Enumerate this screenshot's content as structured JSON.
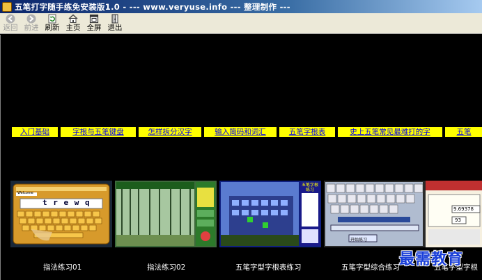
{
  "window": {
    "title": "五笔打字随手练免安装版1.0 - --- www.veryuse.info --- 整理制作 ---"
  },
  "toolbar": {
    "buttons": [
      {
        "label": "返回",
        "icon": "back-arrow-icon",
        "enabled": false
      },
      {
        "label": "前进",
        "icon": "forward-arrow-icon",
        "enabled": false
      },
      {
        "label": "刷新",
        "icon": "refresh-icon",
        "enabled": true
      },
      {
        "label": "主页",
        "icon": "home-icon",
        "enabled": true
      },
      {
        "label": "全屏",
        "icon": "fullscreen-icon",
        "enabled": true
      },
      {
        "label": "退出",
        "icon": "exit-icon",
        "enabled": true
      }
    ]
  },
  "nav_links": [
    {
      "label": "入门基础"
    },
    {
      "label": "字根与五笔键盘"
    },
    {
      "label": "怎样拆分汉字"
    },
    {
      "label": "输入简码和词汇"
    },
    {
      "label": "五笔字根表"
    },
    {
      "label": "史上五笔常见最难打的字"
    },
    {
      "label": "五笔"
    }
  ],
  "thumbnails": [
    {
      "caption": "指法练习01",
      "screen_text": "t r e w q",
      "preview_label": "Welcome"
    },
    {
      "caption": "指法练习02"
    },
    {
      "caption": "五笔字型字根表练习",
      "preview_label": "五笔字根练习"
    },
    {
      "caption": "五笔字型综合练习",
      "preview_label": "开始练习"
    },
    {
      "caption": "五笔字型字根",
      "preview_value": "9.69378",
      "preview_value_2": "93"
    }
  ],
  "watermark": {
    "text": "最需教育"
  },
  "colors": {
    "titlebar_start": "#0a246a",
    "toolbar_bg": "#ece9d8",
    "link_bg": "#ffff00",
    "link_text": "#0000ee",
    "content_bg": "#000000",
    "watermark": "#1a3fd8"
  }
}
